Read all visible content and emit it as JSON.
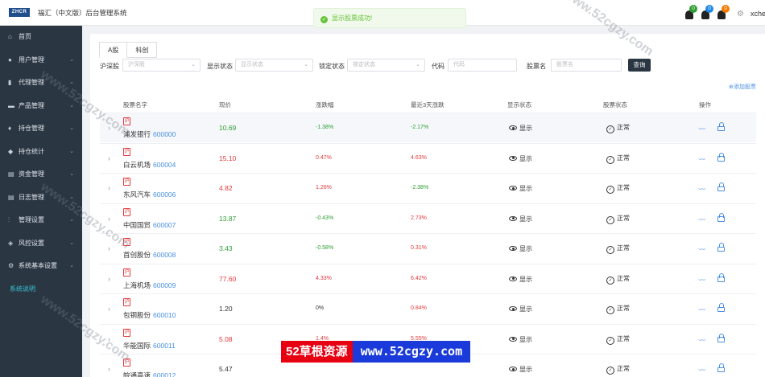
{
  "header": {
    "logo_text": "ZHCR",
    "title": "福汇（中文版）后台管理系统",
    "toast": "显示股票成功!",
    "notifications": [
      {
        "count": "0",
        "color": "#2e9e33"
      },
      {
        "count": "0",
        "color": "#1e88e5"
      },
      {
        "count": "0",
        "color": "#f57c00"
      }
    ],
    "user": "xches"
  },
  "sidebar": {
    "items": [
      {
        "label": "首页",
        "icon": "home-icon",
        "glyph": "⌂"
      },
      {
        "label": "用户管理",
        "icon": "user-icon",
        "glyph": "●"
      },
      {
        "label": "代理管理",
        "icon": "agent-icon",
        "glyph": "▮"
      },
      {
        "label": "产品管理",
        "icon": "product-icon",
        "glyph": "▬"
      },
      {
        "label": "持仓管理",
        "icon": "position-icon",
        "glyph": "♦"
      },
      {
        "label": "持仓统计",
        "icon": "stats-icon",
        "glyph": "◆"
      },
      {
        "label": "资金管理",
        "icon": "funds-icon",
        "glyph": "▤"
      },
      {
        "label": "日志管理",
        "icon": "log-icon",
        "glyph": "▤"
      },
      {
        "label": "管理设置",
        "icon": "settings-icon",
        "glyph": "⫶"
      },
      {
        "label": "风控设置",
        "icon": "risk-icon",
        "glyph": "◈"
      },
      {
        "label": "系统基本设置",
        "icon": "gear-icon",
        "glyph": "⚙"
      },
      {
        "label": "系统说明",
        "icon": "",
        "glyph": ""
      }
    ]
  },
  "tabs": [
    "A股",
    "科创"
  ],
  "filters": {
    "market_label": "沪深股",
    "market_placeholder": "沪深股",
    "display_label": "显示状态",
    "display_placeholder": "显示状态",
    "lock_label": "锁定状态",
    "lock_placeholder": "锁定状态",
    "code_label": "代码",
    "code_placeholder": "代码",
    "name_label": "股票名",
    "name_placeholder": "股票名",
    "query_label": "查询"
  },
  "add_link": "添加股票",
  "table": {
    "headers": [
      "股票名字",
      "现价",
      "涨跌幅",
      "最近3天涨跌",
      "显示状态",
      "股票状态",
      "操作"
    ],
    "exchange_tag": "沪",
    "rows": [
      {
        "name": "浦发银行",
        "code": "600000",
        "price": "10.69",
        "change": "-1.38%",
        "change3": "-2.17%",
        "display": "显示",
        "status": "正常"
      },
      {
        "name": "白云机场",
        "code": "600004",
        "price": "15.10",
        "change": "0.47%",
        "change3": "4.63%",
        "display": "显示",
        "status": "正常"
      },
      {
        "name": "东风汽车",
        "code": "600006",
        "price": "4.82",
        "change": "1.26%",
        "change3": "-2.38%",
        "display": "显示",
        "status": "正常"
      },
      {
        "name": "中国国贸",
        "code": "600007",
        "price": "13.87",
        "change": "-0.43%",
        "change3": "2.73%",
        "display": "显示",
        "status": "正常"
      },
      {
        "name": "首创股份",
        "code": "600008",
        "price": "3.43",
        "change": "-0.58%",
        "change3": "0.31%",
        "display": "显示",
        "status": "正常"
      },
      {
        "name": "上海机场",
        "code": "600009",
        "price": "77.60",
        "change": "4.33%",
        "change3": "6.42%",
        "display": "显示",
        "status": "正常"
      },
      {
        "name": "包钢股份",
        "code": "600010",
        "price": "1.20",
        "change": "0%",
        "change3": "0.84%",
        "display": "显示",
        "status": "正常"
      },
      {
        "name": "华能国际",
        "code": "600011",
        "price": "5.08",
        "change": "1.4%",
        "change3": "5.55%",
        "display": "显示",
        "status": "正常"
      },
      {
        "name": "皖通高速",
        "code": "600012",
        "price": "5.47",
        "change": "",
        "change3": "",
        "display": "显示",
        "status": "正常"
      }
    ]
  },
  "watermark": "www.52cgzy.com",
  "banner": {
    "left": "52草根资源",
    "right": "www.52cgzy.com"
  }
}
